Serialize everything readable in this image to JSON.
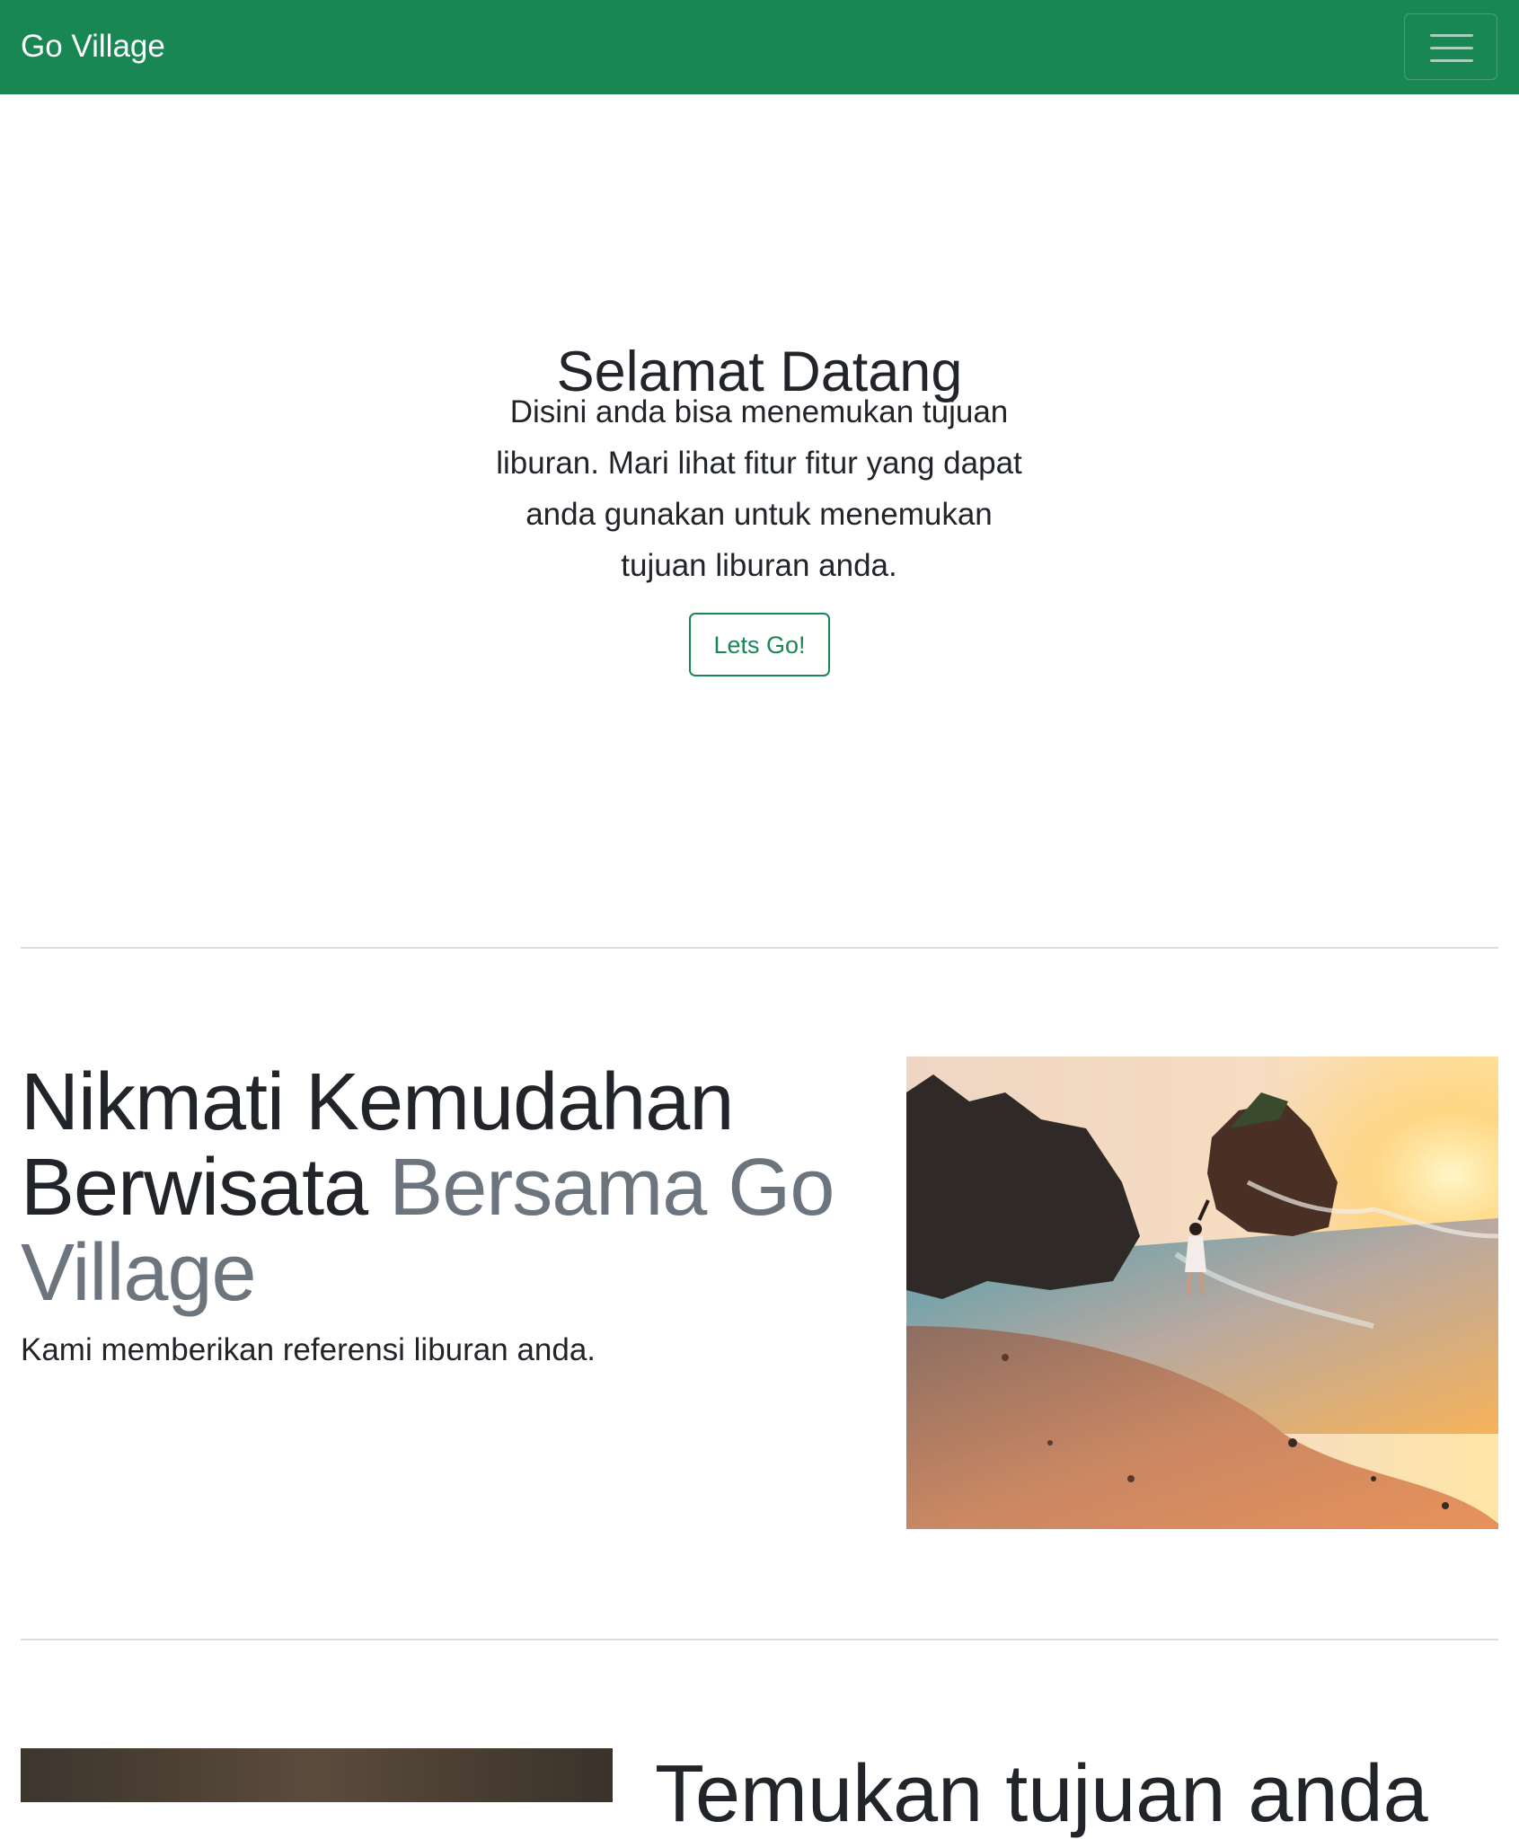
{
  "navbar": {
    "brand": "Go Village",
    "toggler_icon": "hamburger-menu-icon",
    "background_color": "#198754"
  },
  "hero": {
    "title": "Selamat Datang",
    "text": "Disini anda bisa menemukan tujuan liburan. Mari lihat fitur fitur yang dapat anda gunakan untuk menemukan tujuan liburan anda.",
    "button_label": "Lets Go!"
  },
  "feature_1": {
    "heading_main": "Nikmati Kemudahan Berwisata",
    "heading_muted": "Bersama Go Village",
    "lead": "Kami memberikan referensi liburan anda.",
    "image": "beach-sunset-photo"
  },
  "feature_2": {
    "heading": "Temukan tujuan anda",
    "image": "temple-photo"
  },
  "colors": {
    "accent": "#198754",
    "muted_text": "#6c757d",
    "body_text": "#212529"
  }
}
